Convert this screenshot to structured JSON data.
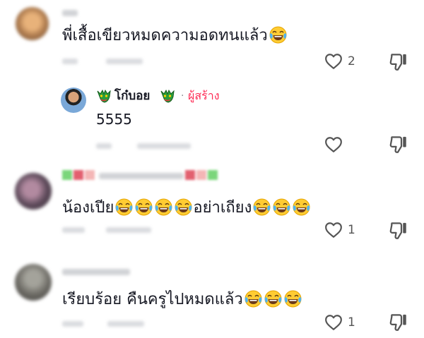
{
  "comments": [
    {
      "text": "พี่เสื้อเขียวหมดความอดทนแล้ว",
      "emojis": [
        "laughing-tears"
      ],
      "like_count": "2"
    },
    {
      "reply": true,
      "author": "โก๋บอย",
      "creator_label": "ผู้สร้าง",
      "separator": "·",
      "text": "5555",
      "like_count": ""
    },
    {
      "text_before": "น้องเปีย",
      "text_after": "อย่าเถียง",
      "like_count": "1"
    },
    {
      "text": "เรียบร้อย คืนครูไปหมดแล้ว",
      "like_count": "1"
    }
  ],
  "colors": {
    "creator_accent": "#fe2c55",
    "text": "#161823",
    "muted": "#8a8b91",
    "icon": "#555555"
  },
  "icons": [
    "heart-outline-icon",
    "thumbs-down-icon",
    "laughing-tears-emoji",
    "dragon-emoji"
  ]
}
